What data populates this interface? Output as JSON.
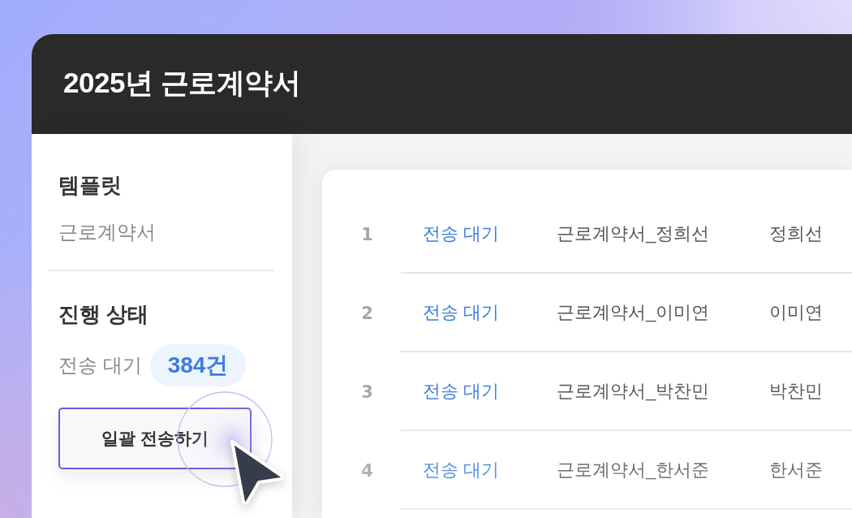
{
  "window": {
    "title": "2025년 근로계약서"
  },
  "sidebar": {
    "template": {
      "heading": "템플릿",
      "value": "근로계약서"
    },
    "progress": {
      "heading": "진행 상태",
      "label": "전송 대기",
      "count": "384건"
    },
    "button": {
      "label": "일괄 전송하기",
      "hovered": true
    }
  },
  "table": {
    "rows": [
      {
        "number": "1",
        "status": "전송 대기",
        "document": "근로계약서_정희선",
        "name": "정희선"
      },
      {
        "number": "2",
        "status": "전송 대기",
        "document": "근로계약서_이미연",
        "name": "이미연"
      },
      {
        "number": "3",
        "status": "전송 대기",
        "document": "근로계약서_박찬민",
        "name": "박찬민"
      },
      {
        "number": "4",
        "status": "전송 대기",
        "document": "근로계약서_한서준",
        "name": "한서준"
      }
    ]
  }
}
